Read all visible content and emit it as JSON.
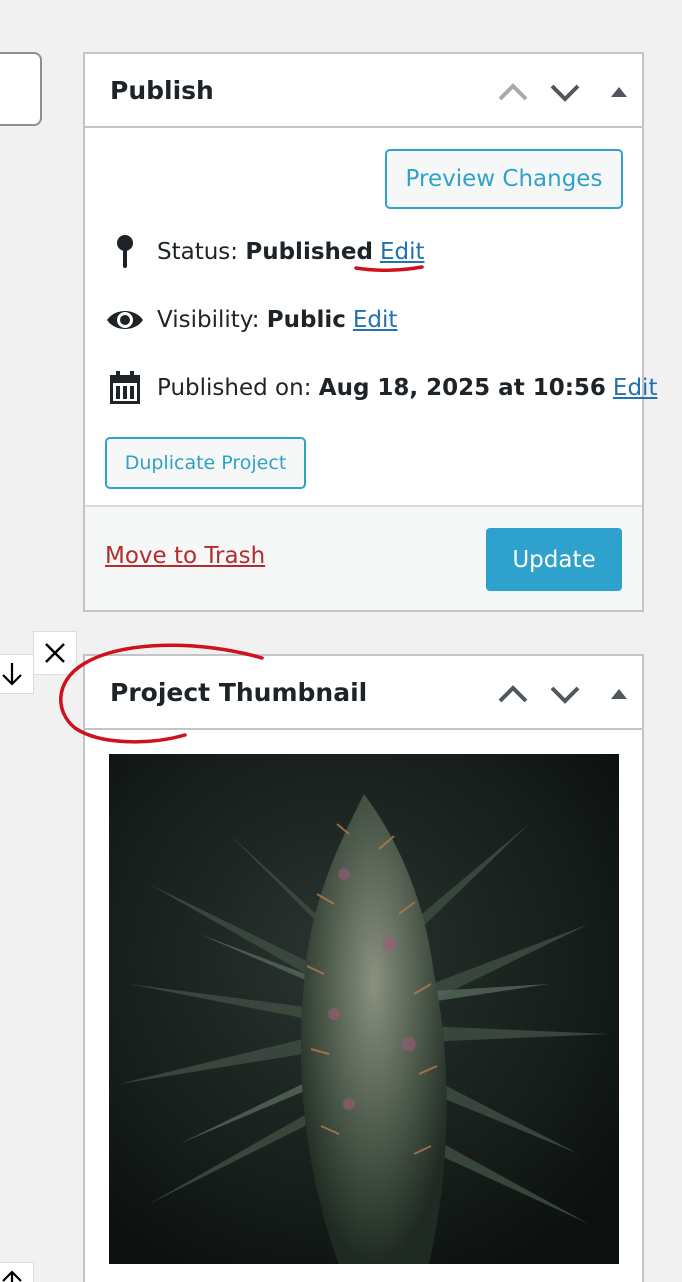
{
  "publish_box": {
    "title": "Publish",
    "preview_label": "Preview Changes",
    "status_label": "Status:",
    "status_value": "Published",
    "visibility_label": "Visibility:",
    "visibility_value": "Public",
    "published_label": "Published on:",
    "published_value": "Aug 18, 2025 at 10:56",
    "edit_label": "Edit",
    "duplicate_label": "Duplicate Project",
    "trash_label": "Move to Trash",
    "update_label": "Update"
  },
  "thumbnail_box": {
    "title": "Project Thumbnail"
  },
  "icons": {
    "move_up": "chevron-up-icon",
    "move_down": "chevron-down-icon",
    "toggle": "triangle-up-icon",
    "status": "pin-icon",
    "visibility": "eye-icon",
    "calendar": "calendar-icon",
    "remove": "close-icon",
    "arrow_down": "arrow-down-icon",
    "arrow_up": "arrow-up-icon"
  },
  "colors": {
    "accent": "#2ea2cc",
    "link": "#2271b1",
    "trash": "#b32d2e",
    "annotation": "#d0101b"
  }
}
